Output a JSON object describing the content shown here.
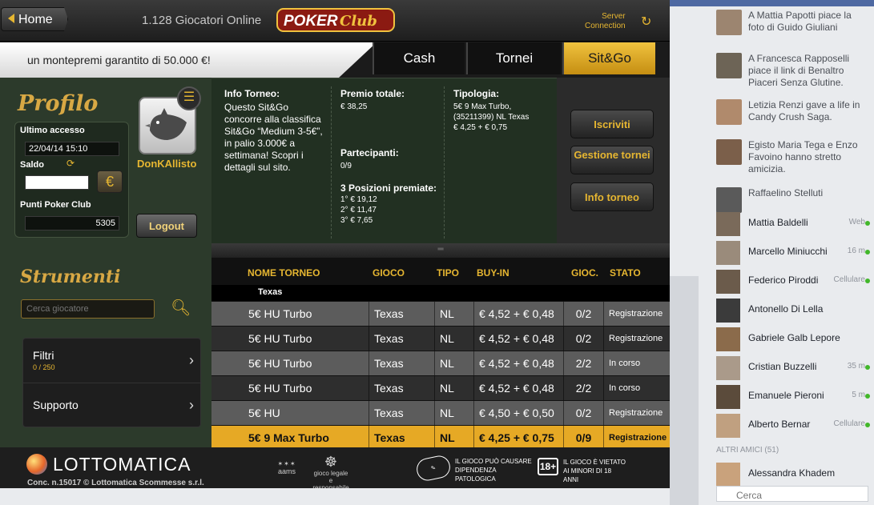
{
  "header": {
    "home_label": "Home",
    "players_online": "1.128 Giocatori Online",
    "logo_text": "POKER Club",
    "server_line1": "Server",
    "server_line2": "Connection"
  },
  "banner": {
    "text": "un montepremi garantito di 50.000 €!"
  },
  "tabs": [
    {
      "label": "Cash"
    },
    {
      "label": "Tornei"
    },
    {
      "label": "Sit&Go",
      "active": true
    }
  ],
  "profile": {
    "title": "Profilo",
    "last_access_label": "Ultimo accesso",
    "last_access_value": "22/04/14 15:10",
    "balance_label": "Saldo",
    "currency_symbol": "€",
    "points_label": "Punti Poker Club",
    "points_value": "5305",
    "username": "DonKAllisto",
    "logout_label": "Logout"
  },
  "tools": {
    "title": "Strumenti",
    "search_placeholder": "Cerca giocatore",
    "items": [
      {
        "label": "Filtri",
        "sub": "0 / 250"
      },
      {
        "label": "Supporto"
      }
    ]
  },
  "info": {
    "info_title": "Info Torneo:",
    "info_text": "Questo Sit&Go concorre alla classifica Sit&Go “Medium 3-5€”, in palio 3.000€ a settimana! Scopri i dettagli sul sito.",
    "prize_title": "Premio totale:",
    "prize_value": "€ 38,25",
    "participants_title": "Partecipanti:",
    "participants_value": "0/9",
    "positions_title": "3 Posizioni premiate:",
    "positions": [
      "1° € 19,12",
      "2° € 11,47",
      "3° € 7,65"
    ],
    "type_title": "Tipologia:",
    "type_lines": [
      "5€ 9 Max Turbo,",
      "(35211399) NL Texas",
      "€ 4,25 + € 0,75"
    ]
  },
  "actions": [
    {
      "label": "Iscriviti"
    },
    {
      "label": "Gestione tornei"
    },
    {
      "label": "Info torneo"
    }
  ],
  "table": {
    "headers": [
      "NOME TORNEO",
      "GIOCO",
      "TIPO",
      "BUY-IN",
      "GIOC.",
      "STATO"
    ],
    "group": "Texas",
    "rows": [
      {
        "name": "5€ HU Turbo",
        "game": "Texas",
        "type": "NL",
        "buyin": "€ 4,52 + € 0,48",
        "players": "0/2",
        "status": "Registrazione"
      },
      {
        "name": "5€ HU Turbo",
        "game": "Texas",
        "type": "NL",
        "buyin": "€ 4,52 + € 0,48",
        "players": "0/2",
        "status": "Registrazione"
      },
      {
        "name": "5€ HU Turbo",
        "game": "Texas",
        "type": "NL",
        "buyin": "€ 4,52 + € 0,48",
        "players": "2/2",
        "status": "In corso"
      },
      {
        "name": "5€ HU Turbo",
        "game": "Texas",
        "type": "NL",
        "buyin": "€ 4,52 + € 0,48",
        "players": "2/2",
        "status": "In corso"
      },
      {
        "name": "5€ HU",
        "game": "Texas",
        "type": "NL",
        "buyin": "€ 4,50 + € 0,50",
        "players": "0/2",
        "status": "Registrazione"
      },
      {
        "name": "5€ 9 Max Turbo",
        "game": "Texas",
        "type": "NL",
        "buyin": "€ 4,25 + € 0,75",
        "players": "0/9",
        "status": "Registrazione",
        "selected": true
      }
    ]
  },
  "footer": {
    "brand": "LOTTOMATICA",
    "concession": "Conc. n.15017 © Lottomatica Scommesse s.r.l.",
    "aams": "aams",
    "responsible": "gioco legale e responsabile",
    "warning1": "IL GIOCO PUÒ CAUSARE DIPENDENZA PATOLOGICA",
    "badge18": "18+",
    "warning2": "IL GIOCO È VIETATO AI MINORI DI 18 ANNI"
  },
  "facebook": {
    "feed": [
      {
        "name": "Mattia Papotti",
        "text": "A Mattia Papotti piace la foto di Guido Giuliani"
      },
      {
        "name": "Francesca Rapposelli",
        "text": "A Francesca Rapposelli piace il link di Benaltro Piaceri Senza Glutine."
      },
      {
        "name": "Letizia Renzi",
        "text": "Letizia Renzi gave a life in Candy Crush Saga."
      },
      {
        "name": "Egisto Maria Tega",
        "text": "Egisto Maria Tega e Enzo Favoino hanno stretto amicizia."
      },
      {
        "name": "Raffaelino Stelluti",
        "text": "Raffaelino Stelluti"
      }
    ],
    "friends": [
      {
        "name": "Mattia Baldelli",
        "status": "Web"
      },
      {
        "name": "Marcello Miniucchi",
        "status": "16 m"
      },
      {
        "name": "Federico Piroddi",
        "status": "Cellulare"
      },
      {
        "name": "Antonello Di Lella",
        "status": ""
      },
      {
        "name": "Gabriele Galb Lepore",
        "status": ""
      },
      {
        "name": "Cristian Buzzelli",
        "status": "35 m"
      },
      {
        "name": "Emanuele Pieroni",
        "status": "5 m"
      },
      {
        "name": "Alberto Bernar",
        "status": "Cellulare"
      }
    ],
    "other_friends": "ALTRI AMICI (51)",
    "other_friend": "Alessandra Khadem",
    "search_placeholder": "Cerca"
  },
  "colors": {
    "gold": "#e6b631",
    "row_light": "#5c5c5c",
    "row_dark": "#2e2e2e",
    "row_selected": "#e6a925",
    "panel_green": "#2c3a2b"
  }
}
